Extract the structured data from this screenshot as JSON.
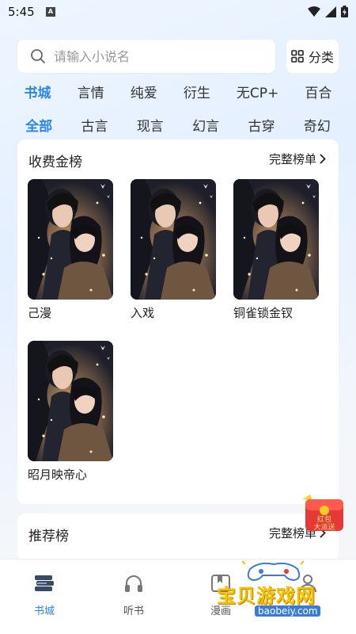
{
  "status": {
    "time": "5:45",
    "badge": "A"
  },
  "search": {
    "placeholder": "请输入小说名",
    "category_label": "分类"
  },
  "tabs": [
    "书城",
    "言情",
    "纯爱",
    "衍生",
    "无CP+",
    "百合"
  ],
  "active_tab": 0,
  "subtabs": [
    "全部",
    "古言",
    "现言",
    "幻言",
    "古穿",
    "奇幻"
  ],
  "active_subtab": 0,
  "rank_card": {
    "title": "收费金榜",
    "more": "完整榜单",
    "books": [
      {
        "title": "己漫"
      },
      {
        "title": "入戏"
      },
      {
        "title": "铜雀锁金钗"
      },
      {
        "title": "昭月映帝心"
      }
    ]
  },
  "rec_card": {
    "title": "推荐榜",
    "more": "完整榜单"
  },
  "bottom_nav": [
    {
      "label": "书城",
      "icon": "bookshelf-icon",
      "active": true
    },
    {
      "label": "听书",
      "icon": "headphones-icon",
      "active": false
    },
    {
      "label": "漫画",
      "icon": "comic-icon",
      "active": false
    },
    {
      "label": "我的",
      "icon": "user-icon",
      "active": false
    }
  ],
  "float_badge": {
    "line1": "红包",
    "line2": "大派送"
  },
  "watermark": {
    "text": "宝贝游戏网",
    "url": "baobeiy.com"
  },
  "colors": {
    "accent": "#2a86ec",
    "text": "#222222",
    "bg": "#eef6ff"
  }
}
